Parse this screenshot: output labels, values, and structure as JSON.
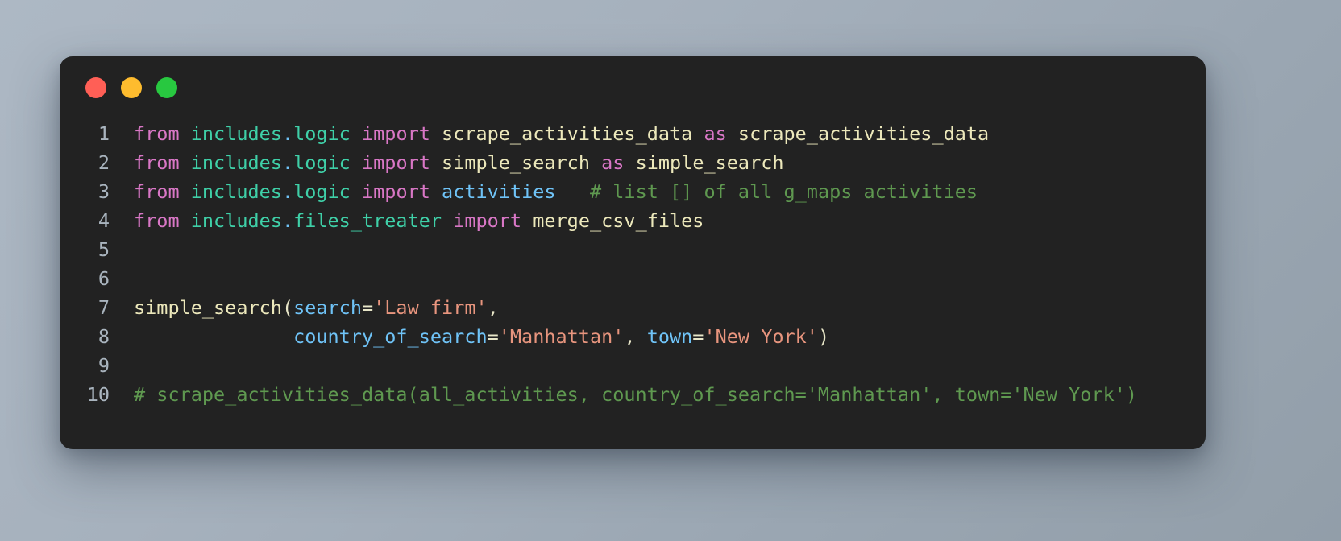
{
  "window": {
    "traffic_lights": [
      {
        "name": "close",
        "color": "#ff5f56"
      },
      {
        "name": "minimize",
        "color": "#febc2e"
      },
      {
        "name": "maximize",
        "color": "#28c840"
      }
    ]
  },
  "theme": {
    "background_start": "#adb8c4",
    "background_end": "#929ea9",
    "card_background": "#222222",
    "line_number_color": "#a9b4be",
    "keyword_color": "#d977c6",
    "module_color": "#3fd0a8",
    "name_color": "#ece8bb",
    "builtin_color": "#6fc3f7",
    "string_color": "#e8957e",
    "comment_color": "#5f9950"
  },
  "editor": {
    "language": "python",
    "line_numbers": [
      "1",
      "2",
      "3",
      "4",
      "5",
      "6",
      "7",
      "8",
      "9",
      "10"
    ],
    "lines": [
      {
        "number": "1",
        "text": "from includes.logic import scrape_activities_data as scrape_activities_data",
        "tokens": [
          {
            "t": "from",
            "c": "tk-keyword"
          },
          {
            "t": " ",
            "c": "tk-punct"
          },
          {
            "t": "includes",
            "c": "tk-module"
          },
          {
            "t": ".",
            "c": "tk-dot"
          },
          {
            "t": "logic",
            "c": "tk-module"
          },
          {
            "t": " ",
            "c": "tk-punct"
          },
          {
            "t": "import",
            "c": "tk-keyword"
          },
          {
            "t": " ",
            "c": "tk-punct"
          },
          {
            "t": "scrape_activities_data",
            "c": "tk-name"
          },
          {
            "t": " ",
            "c": "tk-punct"
          },
          {
            "t": "as",
            "c": "tk-keyword"
          },
          {
            "t": " ",
            "c": "tk-punct"
          },
          {
            "t": "scrape_activities_data",
            "c": "tk-name"
          }
        ]
      },
      {
        "number": "2",
        "text": "from includes.logic import simple_search as simple_search",
        "tokens": [
          {
            "t": "from",
            "c": "tk-keyword"
          },
          {
            "t": " ",
            "c": "tk-punct"
          },
          {
            "t": "includes",
            "c": "tk-module"
          },
          {
            "t": ".",
            "c": "tk-dot"
          },
          {
            "t": "logic",
            "c": "tk-module"
          },
          {
            "t": " ",
            "c": "tk-punct"
          },
          {
            "t": "import",
            "c": "tk-keyword"
          },
          {
            "t": " ",
            "c": "tk-punct"
          },
          {
            "t": "simple_search",
            "c": "tk-name"
          },
          {
            "t": " ",
            "c": "tk-punct"
          },
          {
            "t": "as",
            "c": "tk-keyword"
          },
          {
            "t": " ",
            "c": "tk-punct"
          },
          {
            "t": "simple_search",
            "c": "tk-name"
          }
        ]
      },
      {
        "number": "3",
        "text": "from includes.logic import activities   # list [] of all g_maps activities",
        "tokens": [
          {
            "t": "from",
            "c": "tk-keyword"
          },
          {
            "t": " ",
            "c": "tk-punct"
          },
          {
            "t": "includes",
            "c": "tk-module"
          },
          {
            "t": ".",
            "c": "tk-dot"
          },
          {
            "t": "logic",
            "c": "tk-module"
          },
          {
            "t": " ",
            "c": "tk-punct"
          },
          {
            "t": "import",
            "c": "tk-keyword"
          },
          {
            "t": " ",
            "c": "tk-punct"
          },
          {
            "t": "activities",
            "c": "tk-builtin"
          },
          {
            "t": "   ",
            "c": "tk-punct"
          },
          {
            "t": "# list [] of all g_maps activities",
            "c": "tk-comment"
          }
        ]
      },
      {
        "number": "4",
        "text": "from includes.files_treater import merge_csv_files",
        "tokens": [
          {
            "t": "from",
            "c": "tk-keyword"
          },
          {
            "t": " ",
            "c": "tk-punct"
          },
          {
            "t": "includes",
            "c": "tk-module"
          },
          {
            "t": ".",
            "c": "tk-dot"
          },
          {
            "t": "files_treater",
            "c": "tk-module"
          },
          {
            "t": " ",
            "c": "tk-punct"
          },
          {
            "t": "import",
            "c": "tk-keyword"
          },
          {
            "t": " ",
            "c": "tk-punct"
          },
          {
            "t": "merge_csv_files",
            "c": "tk-name"
          }
        ]
      },
      {
        "number": "5",
        "text": "",
        "tokens": []
      },
      {
        "number": "6",
        "text": "",
        "tokens": []
      },
      {
        "number": "7",
        "text": "simple_search(search='Law firm',",
        "tokens": [
          {
            "t": "simple_search",
            "c": "tk-name"
          },
          {
            "t": "(",
            "c": "tk-punct"
          },
          {
            "t": "search",
            "c": "tk-builtin"
          },
          {
            "t": "=",
            "c": "tk-punct"
          },
          {
            "t": "'Law firm'",
            "c": "tk-string"
          },
          {
            "t": ",",
            "c": "tk-punct"
          }
        ]
      },
      {
        "number": "8",
        "text": "              country_of_search='Manhattan', town='New York')",
        "tokens": [
          {
            "t": "              ",
            "c": "tk-punct"
          },
          {
            "t": "country_of_search",
            "c": "tk-builtin"
          },
          {
            "t": "=",
            "c": "tk-punct"
          },
          {
            "t": "'Manhattan'",
            "c": "tk-string"
          },
          {
            "t": ", ",
            "c": "tk-punct"
          },
          {
            "t": "town",
            "c": "tk-builtin"
          },
          {
            "t": "=",
            "c": "tk-punct"
          },
          {
            "t": "'New York'",
            "c": "tk-string"
          },
          {
            "t": ")",
            "c": "tk-punct"
          }
        ]
      },
      {
        "number": "9",
        "text": "",
        "tokens": []
      },
      {
        "number": "10",
        "text": "# scrape_activities_data(all_activities, country_of_search='Manhattan', town='New York')",
        "tokens": [
          {
            "t": "# scrape_activities_data(all_activities, country_of_search='Manhattan', town='New York')",
            "c": "tk-comment"
          }
        ]
      }
    ]
  }
}
